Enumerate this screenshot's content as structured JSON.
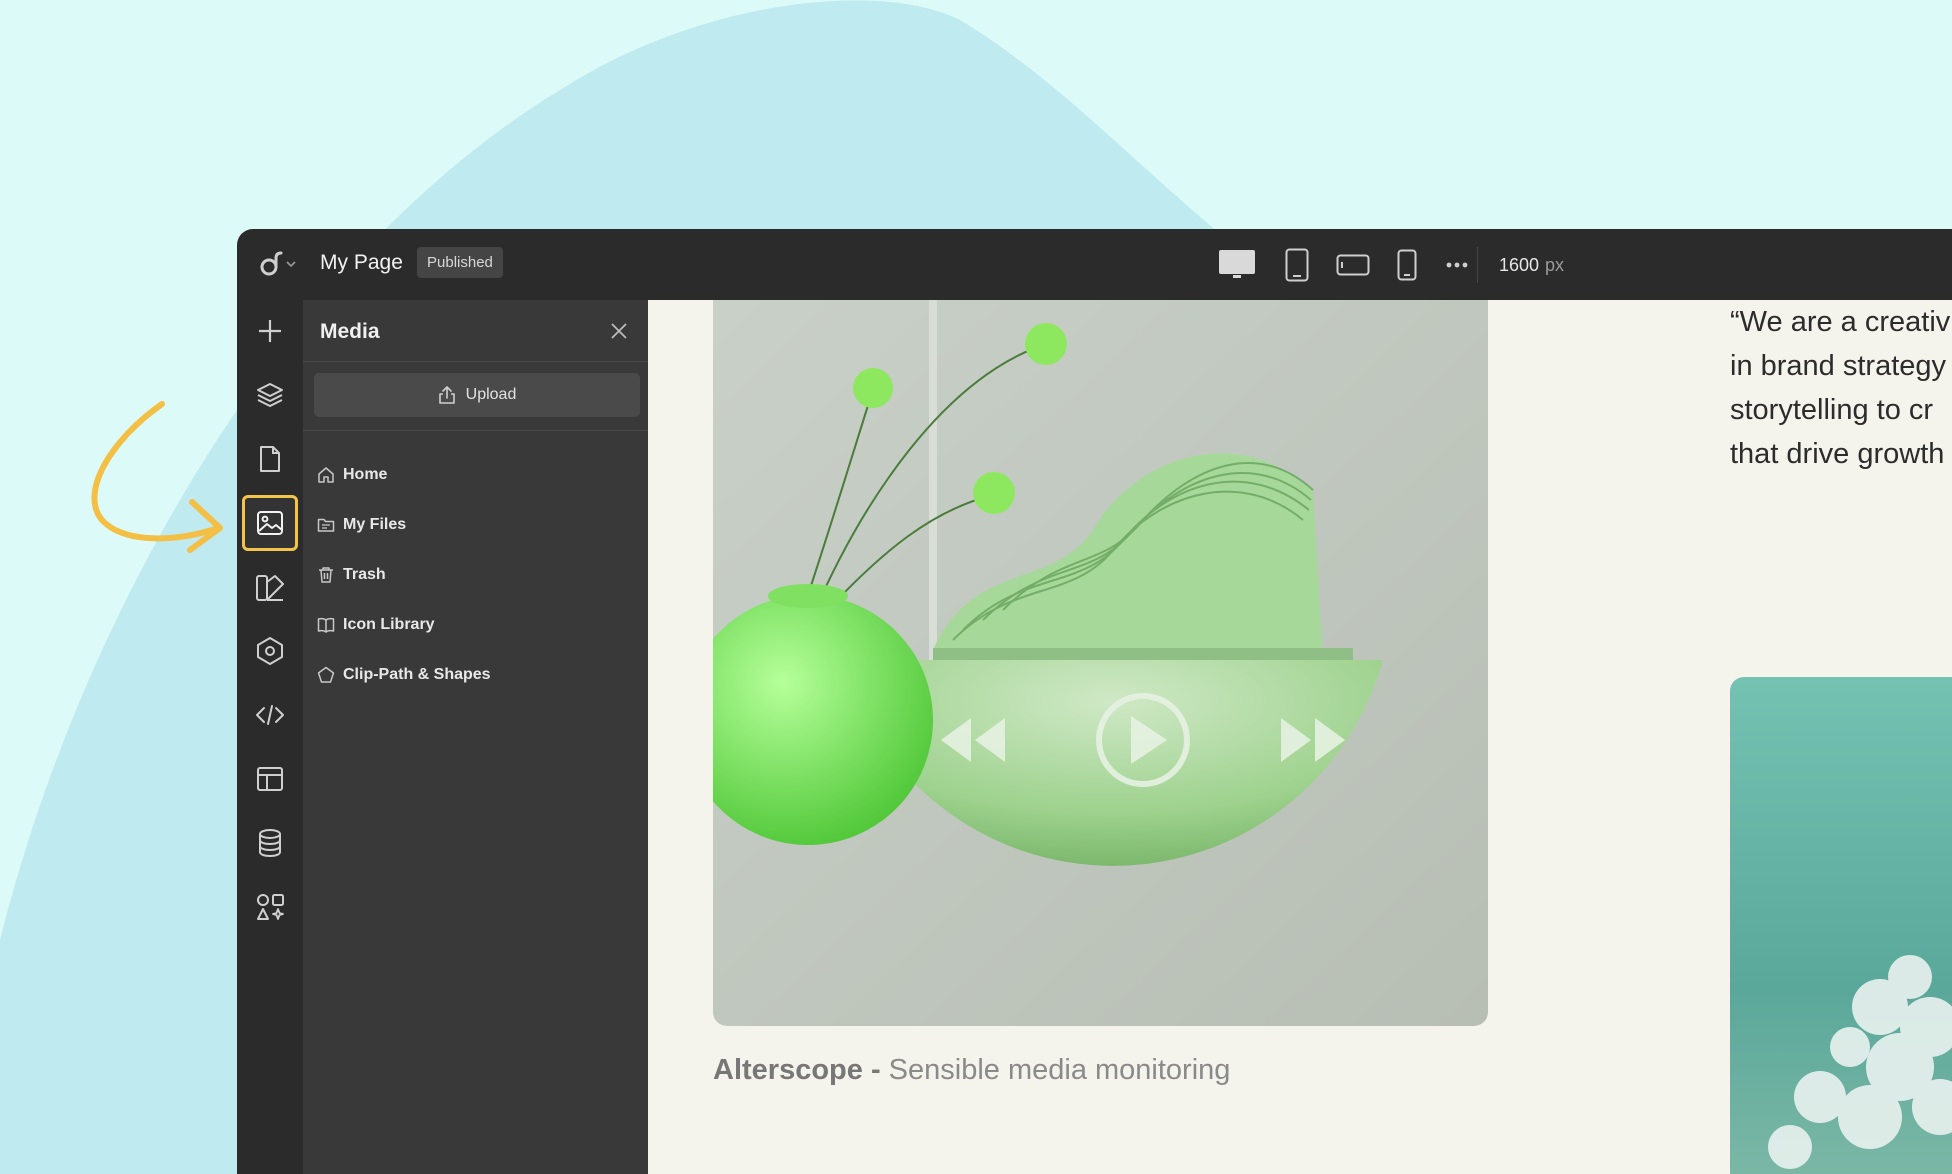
{
  "topbar": {
    "page_title": "My Page",
    "status": "Published",
    "width_value": "1600",
    "width_unit": "px",
    "devices": [
      "desktop-icon",
      "tablet-icon",
      "tablet-landscape-icon",
      "phone-icon",
      "more-icon"
    ]
  },
  "rail": {
    "items": [
      "add-icon",
      "layers-icon",
      "page-icon",
      "media-icon",
      "style-icon",
      "component-icon",
      "code-icon",
      "layout-icon",
      "database-icon",
      "apps-icon"
    ],
    "active": "media-icon"
  },
  "media_panel": {
    "title": "Media",
    "upload_label": "Upload",
    "nav": [
      {
        "label": "Home",
        "icon": "home-icon"
      },
      {
        "label": "My Files",
        "icon": "folder-icon"
      },
      {
        "label": "Trash",
        "icon": "trash-icon"
      },
      {
        "label": "Icon Library",
        "icon": "book-icon"
      },
      {
        "label": "Clip-Path & Shapes",
        "icon": "pentagon-icon"
      }
    ]
  },
  "canvas": {
    "caption_strong": "Alterscope -",
    "caption_rest": " Sensible media monitoring",
    "quote_lines": [
      "“We are a creativ",
      "in brand strategy",
      "storytelling to cr",
      "that drive growth"
    ]
  },
  "colors": {
    "background": "#dcfbf8",
    "blob": "#bfeaf0",
    "chrome": "#2b2b2b",
    "panel": "#393939",
    "highlight": "#f2c54a",
    "canvas": "#f4f3ec"
  }
}
